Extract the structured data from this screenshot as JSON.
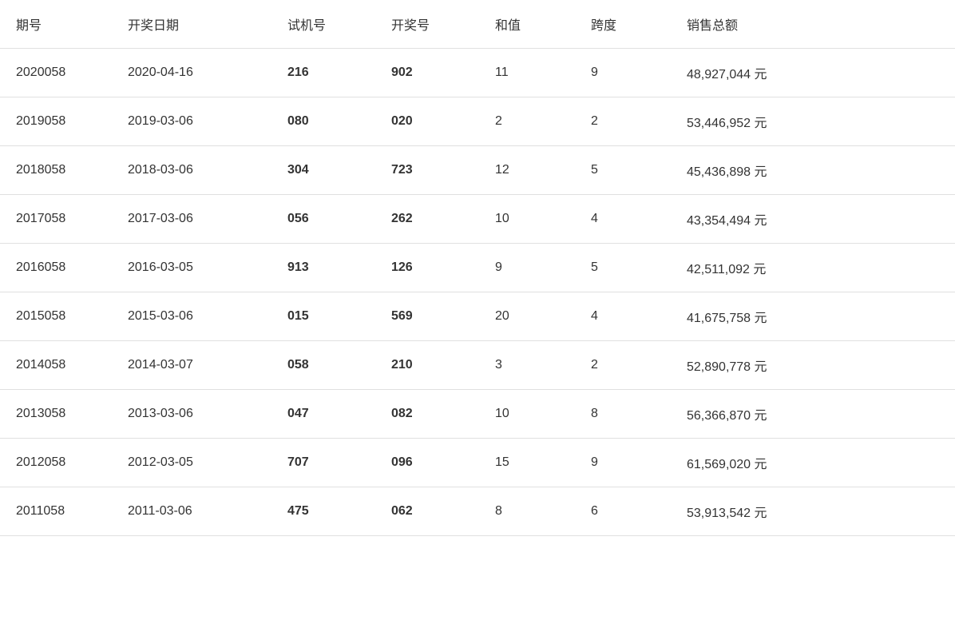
{
  "table": {
    "headers": [
      "期号",
      "开奖日期",
      "试机号",
      "开奖号",
      "和值",
      "跨度",
      "销售总额"
    ],
    "rows": [
      {
        "qihao": "2020058",
        "date": "2020-04-16",
        "shiji": "216",
        "kaijang": "902",
        "hezhi": "11",
        "kuadu": "9",
        "sales": "48,927,044 元"
      },
      {
        "qihao": "2019058",
        "date": "2019-03-06",
        "shiji": "080",
        "kaijang": "020",
        "hezhi": "2",
        "kuadu": "2",
        "sales": "53,446,952 元"
      },
      {
        "qihao": "2018058",
        "date": "2018-03-06",
        "shiji": "304",
        "kaijang": "723",
        "hezhi": "12",
        "kuadu": "5",
        "sales": "45,436,898 元"
      },
      {
        "qihao": "2017058",
        "date": "2017-03-06",
        "shiji": "056",
        "kaijang": "262",
        "hezhi": "10",
        "kuadu": "4",
        "sales": "43,354,494 元"
      },
      {
        "qihao": "2016058",
        "date": "2016-03-05",
        "shiji": "913",
        "kaijang": "126",
        "hezhi": "9",
        "kuadu": "5",
        "sales": "42,511,092 元"
      },
      {
        "qihao": "2015058",
        "date": "2015-03-06",
        "shiji": "015",
        "kaijang": "569",
        "hezhi": "20",
        "kuadu": "4",
        "sales": "41,675,758 元"
      },
      {
        "qihao": "2014058",
        "date": "2014-03-07",
        "shiji": "058",
        "kaijang": "210",
        "hezhi": "3",
        "kuadu": "2",
        "sales": "52,890,778 元"
      },
      {
        "qihao": "2013058",
        "date": "2013-03-06",
        "shiji": "047",
        "kaijang": "082",
        "hezhi": "10",
        "kuadu": "8",
        "sales": "56,366,870 元"
      },
      {
        "qihao": "2012058",
        "date": "2012-03-05",
        "shiji": "707",
        "kaijang": "096",
        "hezhi": "15",
        "kuadu": "9",
        "sales": "61,569,020 元"
      },
      {
        "qihao": "2011058",
        "date": "2011-03-06",
        "shiji": "475",
        "kaijang": "062",
        "hezhi": "8",
        "kuadu": "6",
        "sales": "53,913,542 元"
      }
    ]
  }
}
